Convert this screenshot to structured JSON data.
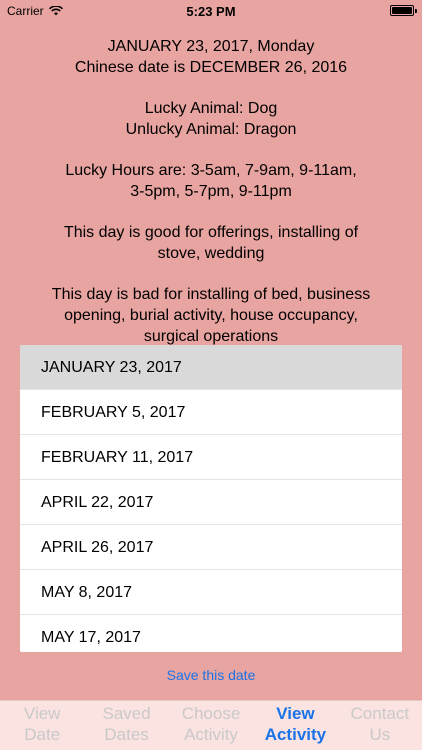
{
  "status": {
    "carrier": "Carrier",
    "time": "5:23 PM"
  },
  "info": {
    "date_line": "JANUARY 23, 2017, Monday",
    "chinese_date": "Chinese date is DECEMBER 26, 2016",
    "lucky_animal": "Lucky Animal: Dog",
    "unlucky_animal": "Unlucky Animal: Dragon",
    "lucky_hours_1": "Lucky Hours are: 3-5am, 7-9am, 9-11am,",
    "lucky_hours_2": "3-5pm, 5-7pm, 9-11pm",
    "good_1": "This day is good for offerings, installing of",
    "good_2": "stove, wedding",
    "bad_1": "This day is bad for installing of bed, business",
    "bad_2": "opening, burial activity, house occupancy,",
    "bad_3": "surgical operations"
  },
  "picker": {
    "items": [
      "JANUARY 23, 2017",
      "FEBRUARY 5, 2017",
      "FEBRUARY 11, 2017",
      "APRIL 22, 2017",
      "APRIL 26, 2017",
      "MAY 8, 2017",
      "MAY 17, 2017"
    ],
    "selected": "JANUARY 23, 2017"
  },
  "save_label": "Save this date",
  "tabs": [
    {
      "label": "View\nDate",
      "active": false
    },
    {
      "label": "Saved\nDates",
      "active": false
    },
    {
      "label": "Choose\nActivity",
      "active": false
    },
    {
      "label": "View\nActivity",
      "active": true
    },
    {
      "label": "Contact\nUs",
      "active": false
    }
  ],
  "colors": {
    "background": "#e8a4a0",
    "accent": "#1a73e8",
    "tab_bar": "#fbe3e2"
  }
}
